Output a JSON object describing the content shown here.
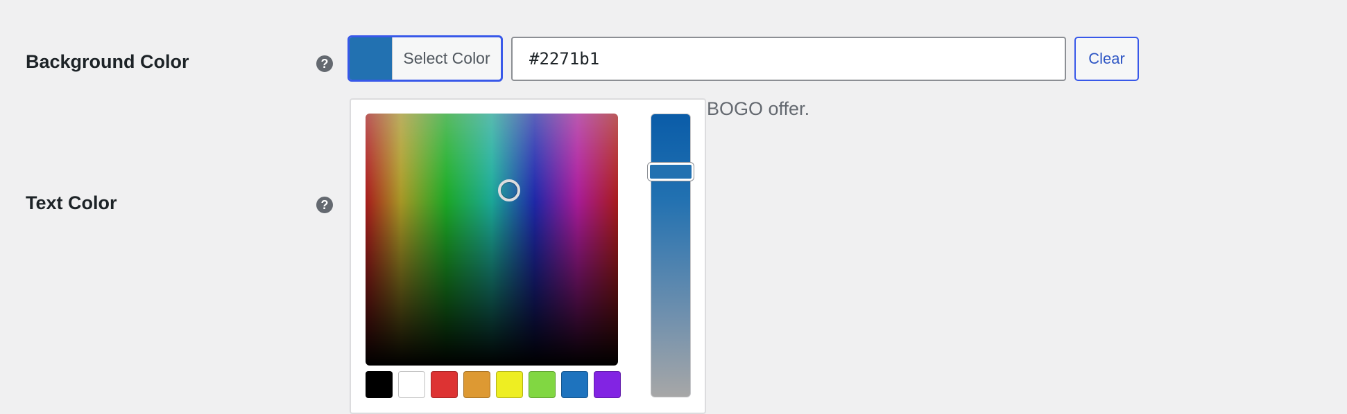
{
  "fields": {
    "background_color": {
      "label": "Background Color",
      "help": "?"
    },
    "text_color": {
      "label": "Text Color",
      "help": "?"
    }
  },
  "color_control": {
    "select_label": "Select Color",
    "current_value": "#2271b1",
    "clear_label": "Clear",
    "description_visible": "BOGO offer."
  },
  "picker": {
    "selected_color": "#2271b1",
    "palette": [
      {
        "name": "black",
        "color": "#000000"
      },
      {
        "name": "white",
        "color": "#ffffff"
      },
      {
        "name": "red",
        "color": "#dd3333"
      },
      {
        "name": "orange",
        "color": "#dd9933"
      },
      {
        "name": "yellow",
        "color": "#eeee22"
      },
      {
        "name": "green",
        "color": "#81d742"
      },
      {
        "name": "blue",
        "color": "#1e73be"
      },
      {
        "name": "purple",
        "color": "#8224e3"
      }
    ]
  }
}
